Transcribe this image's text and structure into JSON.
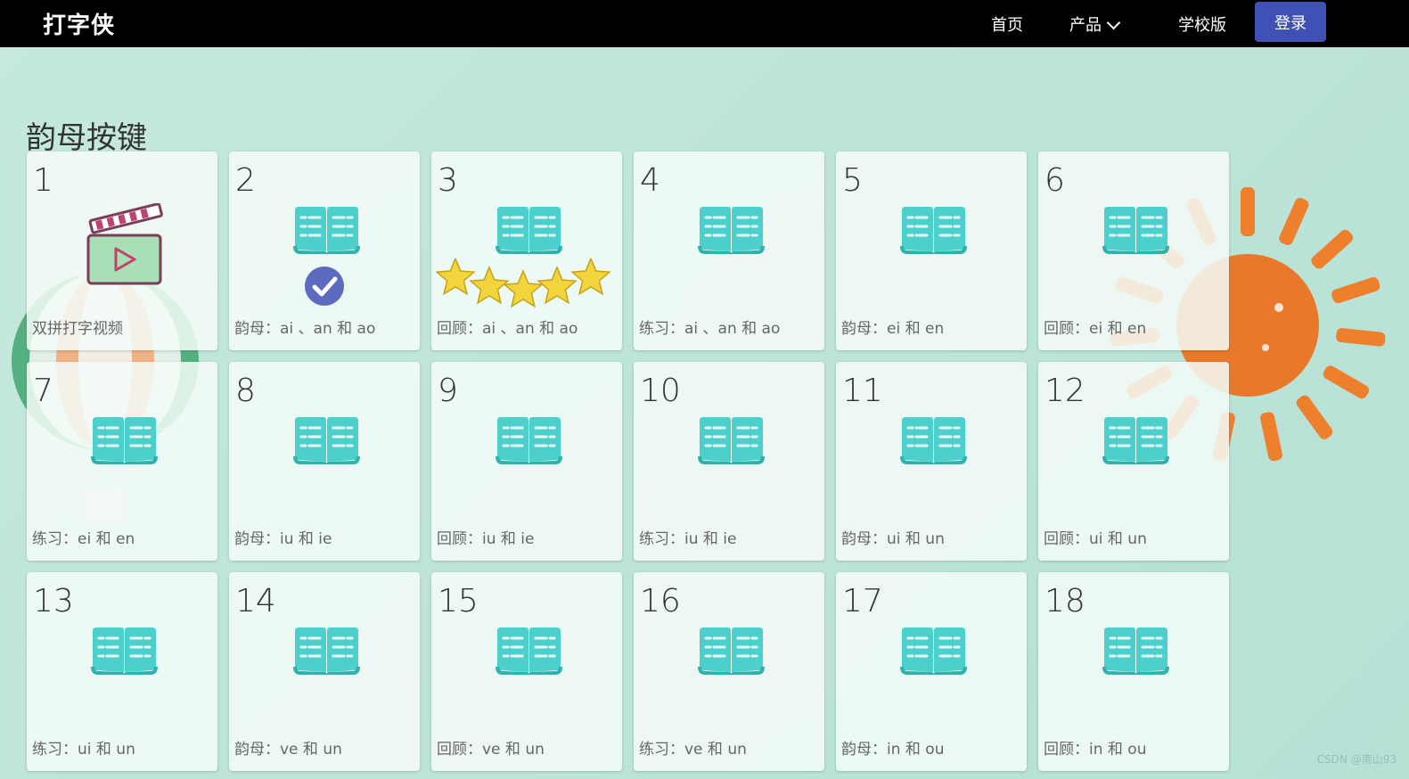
{
  "header": {
    "brand": "打字侠",
    "nav": {
      "home": "首页",
      "products": "产品",
      "school": "学校版"
    },
    "login": "登录"
  },
  "page": {
    "title": "韵母按键"
  },
  "lessons": [
    {
      "num": "1",
      "label": "双拼打字视频",
      "icon": "video-clapper-icon"
    },
    {
      "num": "2",
      "label": "韵母：ai 、an 和 ao",
      "icon": "book-icon",
      "status": "completed-check"
    },
    {
      "num": "3",
      "label": "回顾：ai 、an 和 ao",
      "icon": "book-icon",
      "stars": 5
    },
    {
      "num": "4",
      "label": "练习：ai 、an 和 ao",
      "icon": "book-icon"
    },
    {
      "num": "5",
      "label": "韵母：ei 和 en",
      "icon": "book-icon"
    },
    {
      "num": "6",
      "label": "回顾：ei 和 en",
      "icon": "book-icon"
    },
    {
      "num": "7",
      "label": "练习：ei 和 en",
      "icon": "book-icon"
    },
    {
      "num": "8",
      "label": "韵母：iu 和 ie",
      "icon": "book-icon"
    },
    {
      "num": "9",
      "label": "回顾：iu 和 ie",
      "icon": "book-icon"
    },
    {
      "num": "10",
      "label": "练习：iu 和 ie",
      "icon": "book-icon"
    },
    {
      "num": "11",
      "label": "韵母：ui 和 un",
      "icon": "book-icon"
    },
    {
      "num": "12",
      "label": "回顾：ui 和 un",
      "icon": "book-icon"
    },
    {
      "num": "13",
      "label": "练习：ui 和 un",
      "icon": "book-icon"
    },
    {
      "num": "14",
      "label": "韵母：ve 和 un",
      "icon": "book-icon"
    },
    {
      "num": "15",
      "label": "回顾：ve 和 un",
      "icon": "book-icon"
    },
    {
      "num": "16",
      "label": "练习：ve 和 un",
      "icon": "book-icon"
    },
    {
      "num": "17",
      "label": "韵母：in 和 ou",
      "icon": "book-icon"
    },
    {
      "num": "18",
      "label": "回顾：in 和 ou",
      "icon": "book-icon"
    }
  ],
  "watermark": "CSDN @南山93",
  "colors": {
    "topbar": "#000000",
    "accent": "#3f51b5",
    "book": "#4dd0cc",
    "check": "#5c6bc0",
    "star": "#f2d43d"
  }
}
